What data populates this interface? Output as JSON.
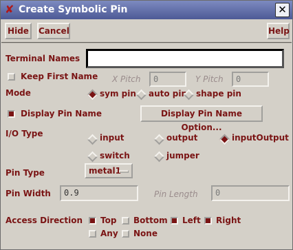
{
  "window": {
    "title": "Create Symbolic Pin",
    "close_glyph": "✕",
    "app_glyph": "✘"
  },
  "toolbar": {
    "hide_label": "Hide",
    "cancel_label": "Cancel",
    "help_label": "Help"
  },
  "form": {
    "terminal_names": {
      "label": "Terminal Names",
      "value": ""
    },
    "keep_first_name": {
      "label": "Keep First Name",
      "checked": false
    },
    "x_pitch": {
      "label": "X Pitch",
      "value": "0"
    },
    "y_pitch": {
      "label": "Y Pitch",
      "value": "0"
    },
    "mode": {
      "label": "Mode",
      "options": [
        "sym pin",
        "auto pin",
        "shape pin"
      ],
      "selected": "sym pin"
    },
    "display_pin_name": {
      "label": "Display Pin Name",
      "checked": true
    },
    "display_pin_name_option_button": "Display Pin Name Option...",
    "io_type": {
      "label": "I/O Type",
      "options": [
        "input",
        "output",
        "inputOutput",
        "switch",
        "jumper"
      ],
      "selected": "inputOutput"
    },
    "pin_type": {
      "label": "Pin Type",
      "value": "metal1"
    },
    "pin_width": {
      "label": "Pin Width",
      "value": "0.9"
    },
    "pin_length": {
      "label": "Pin Length",
      "value": "0"
    },
    "access_direction": {
      "label": "Access Direction",
      "options": [
        "Top",
        "Bottom",
        "Left",
        "Right",
        "Any",
        "None"
      ],
      "checked": [
        "Top",
        "Left",
        "Right"
      ]
    }
  },
  "colors": {
    "label_color": "#7a1414",
    "dialog_bg": "#d4d0c8",
    "titlebar": "#5a67a4"
  }
}
